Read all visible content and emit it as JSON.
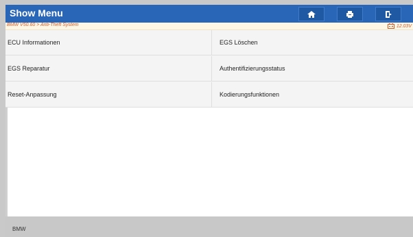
{
  "header": {
    "title": "Show Menu"
  },
  "toolbar": {
    "home_icon": "home-icon",
    "print_icon": "printer-icon",
    "exit_icon": "exit-icon"
  },
  "breadcrumb": {
    "text": "BMW V50.60 > Anti-Theft System"
  },
  "status": {
    "voltage": "12.03V",
    "battery_icon": "battery-icon"
  },
  "menu": {
    "items": [
      {
        "label": "ECU Informationen"
      },
      {
        "label": "EGS Löschen"
      },
      {
        "label": "EGS Reparatur"
      },
      {
        "label": "Authentifizierungsstatus"
      },
      {
        "label": "Reset-Anpassung"
      },
      {
        "label": "Kodierungsfunktionen"
      }
    ]
  },
  "footer": {
    "label": "BMW"
  },
  "colors": {
    "titlebar": "#2a66b7",
    "accent_text": "#d05a2a",
    "background": "#c9c9c9"
  }
}
